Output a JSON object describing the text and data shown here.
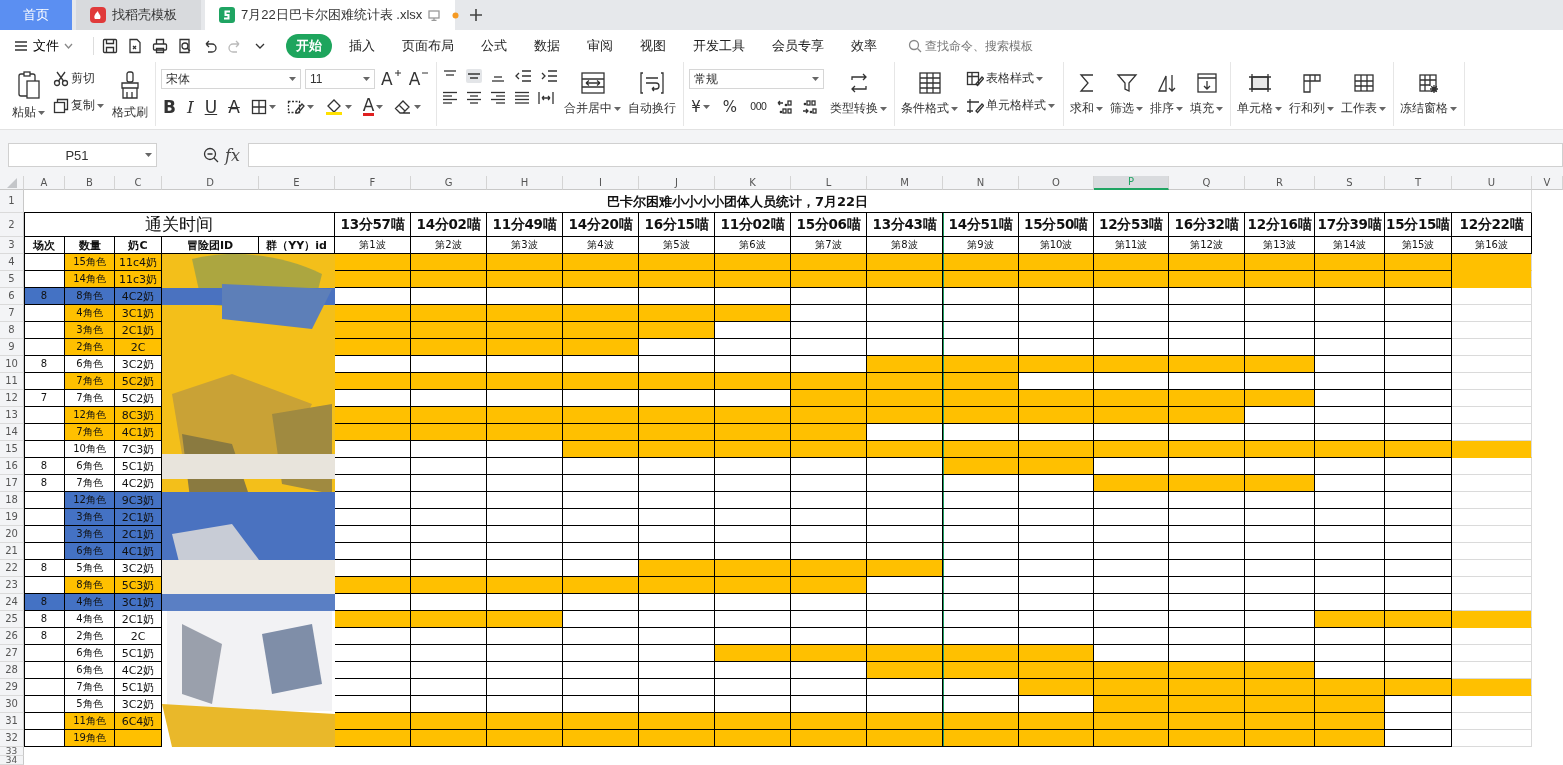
{
  "tabs": [
    {
      "label": "首页",
      "kind": "home",
      "selected": false
    },
    {
      "label": "找稻壳模板",
      "kind": "template",
      "selected": false
    },
    {
      "label": "7月22日巴卡尔困难统计表 .xlsx",
      "kind": "file",
      "selected": true,
      "unsaved": true
    }
  ],
  "menu": {
    "file": "文件",
    "tabs": [
      {
        "label": "开始",
        "selected": true
      },
      {
        "label": "插入",
        "selected": false
      },
      {
        "label": "页面布局",
        "selected": false
      },
      {
        "label": "公式",
        "selected": false
      },
      {
        "label": "数据",
        "selected": false
      },
      {
        "label": "审阅",
        "selected": false
      },
      {
        "label": "视图",
        "selected": false
      },
      {
        "label": "开发工具",
        "selected": false
      },
      {
        "label": "会员专享",
        "selected": false
      },
      {
        "label": "效率",
        "selected": false
      }
    ],
    "search": {
      "placeholder": "查找命令、搜索模板"
    }
  },
  "ribbon": [
    {
      "kind": "clipboard",
      "paste": "粘贴",
      "cut": "剪切",
      "copy": "复制",
      "painter": "格式刷"
    },
    {
      "kind": "font",
      "font": "宋体",
      "size": "11",
      "grow": "A",
      "shrink": "A",
      "bold": "B",
      "italic": "I",
      "underline": "U",
      "strike": "A",
      "font_color": "A"
    },
    {
      "kind": "align",
      "merge": "合并居中",
      "wrap": "自动换行"
    },
    {
      "kind": "number",
      "format": "常规",
      "currency": "¥",
      "percent": "%",
      "thousands": "000",
      "convert": "类型转换"
    },
    {
      "kind": "styles",
      "conditional": "条件格式",
      "table_style": "表格样式",
      "cell_style": "单元格样式"
    },
    {
      "kind": "buttons",
      "items": [
        "求和",
        "筛选",
        "排序",
        "填充"
      ]
    },
    {
      "kind": "buttons",
      "items": [
        "单元格",
        "行和列",
        "工作表"
      ]
    },
    {
      "kind": "buttons",
      "items": [
        "冻结窗格"
      ]
    }
  ],
  "formula_bar": {
    "name_box": "P51",
    "fx": "fx"
  },
  "sheet": {
    "columns": [
      {
        "letter": "A",
        "selected": false
      },
      {
        "letter": "B",
        "selected": false
      },
      {
        "letter": "C",
        "selected": false
      },
      {
        "letter": "D",
        "selected": false
      },
      {
        "letter": "E",
        "selected": false
      },
      {
        "letter": "F",
        "selected": false
      },
      {
        "letter": "G",
        "selected": false
      },
      {
        "letter": "H",
        "selected": false
      },
      {
        "letter": "I",
        "selected": false
      },
      {
        "letter": "J",
        "selected": false
      },
      {
        "letter": "K",
        "selected": false
      },
      {
        "letter": "L",
        "selected": false
      },
      {
        "letter": "M",
        "selected": false
      },
      {
        "letter": "N",
        "selected": false
      },
      {
        "letter": "O",
        "selected": false
      },
      {
        "letter": "P",
        "selected": true
      },
      {
        "letter": "Q",
        "selected": false
      },
      {
        "letter": "R",
        "selected": false
      },
      {
        "letter": "S",
        "selected": false
      },
      {
        "letter": "T",
        "selected": false
      },
      {
        "letter": "U",
        "selected": false
      },
      {
        "letter": "V",
        "selected": false
      }
    ],
    "title": {
      "row": "1",
      "text": "巴卡尔困难小小小小团体人员统计，7月22日"
    },
    "time_row": {
      "row": "2",
      "label": "通关时间",
      "times": [
        "13分57喵",
        "14分02喵",
        "11分49喵",
        "14分20喵",
        "16分15喵",
        "11分02喵",
        "15分06喵",
        "13分43喵",
        "14分51喵",
        "15分50喵",
        "12分53喵",
        "16分32喵",
        "12分16喵",
        "17分39喵",
        "15分15喵",
        "12分22喵"
      ]
    },
    "header_row": {
      "row": "3",
      "headers": [
        "场次",
        "数量",
        "奶C",
        "冒险团ID",
        "群（YY）id"
      ],
      "waves": [
        "第1波",
        "第2波",
        "第3波",
        "第4波",
        "第5波",
        "第6波",
        "第7波",
        "第8波",
        "第9波",
        "第10波",
        "第11波",
        "第12波",
        "第13波",
        "第14波",
        "第15波",
        "第16波"
      ]
    },
    "rows": [
      {
        "row": "4",
        "session": {
          "color": "#ffffff"
        },
        "count": "15角色",
        "healer": "11c4奶",
        "color": "#ffc000",
        "filled": [
          true,
          true,
          true,
          true,
          true,
          true,
          true,
          true,
          true,
          true,
          true,
          true,
          true,
          true,
          true,
          true
        ]
      },
      {
        "row": "5",
        "session": {
          "color": "#ffffff"
        },
        "count": "14角色",
        "healer": "11c3奶",
        "color": "#ffc000",
        "filled": [
          true,
          true,
          true,
          true,
          true,
          true,
          true,
          true,
          true,
          true,
          true,
          true,
          true,
          true,
          true,
          true
        ]
      },
      {
        "row": "6",
        "session": {
          "text": "8",
          "color": "#4472c4"
        },
        "count": "8角色",
        "healer": "4C2奶",
        "color": "#4472c4",
        "filled": [
          false,
          false,
          false,
          false,
          false,
          false,
          false,
          false,
          false,
          false,
          false,
          false,
          false,
          false,
          false,
          false
        ]
      },
      {
        "row": "7",
        "session": {
          "color": "#ffffff"
        },
        "count": "4角色",
        "healer": "3C1奶",
        "color": "#ffc000",
        "filled": [
          true,
          true,
          true,
          true,
          true,
          true,
          false,
          false,
          false,
          false,
          false,
          false,
          false,
          false,
          false,
          false
        ]
      },
      {
        "row": "8",
        "session": {
          "color": "#ffffff"
        },
        "count": "3角色",
        "healer": "2C1奶",
        "color": "#ffc000",
        "filled": [
          true,
          true,
          true,
          true,
          true,
          false,
          false,
          false,
          false,
          false,
          false,
          false,
          false,
          false,
          false,
          false
        ]
      },
      {
        "row": "9",
        "session": {
          "color": "#ffffff"
        },
        "count": "2角色",
        "healer": "2C",
        "color": "#ffc000",
        "filled": [
          true,
          true,
          true,
          true,
          false,
          false,
          false,
          false,
          false,
          false,
          false,
          false,
          false,
          false,
          false,
          false
        ]
      },
      {
        "row": "10",
        "session": {
          "text": "8",
          "color": "#ffffff"
        },
        "count": "6角色",
        "healer": "3C2奶",
        "color": "#ffffff",
        "filled": [
          false,
          false,
          false,
          false,
          false,
          false,
          false,
          true,
          true,
          true,
          true,
          true,
          true,
          false,
          false,
          false
        ]
      },
      {
        "row": "11",
        "session": {
          "color": "#ffffff"
        },
        "count": "7角色",
        "healer": "5C2奶",
        "color": "#ffc000",
        "filled": [
          true,
          true,
          true,
          true,
          true,
          true,
          true,
          true,
          true,
          false,
          false,
          false,
          false,
          false,
          false,
          false
        ]
      },
      {
        "row": "12",
        "session": {
          "text": "7",
          "color": "#ffffff"
        },
        "count": "7角色",
        "healer": "5C2奶",
        "color": "#ffffff",
        "filled": [
          false,
          false,
          false,
          false,
          false,
          false,
          true,
          true,
          true,
          true,
          true,
          true,
          true,
          false,
          false,
          false
        ]
      },
      {
        "row": "13",
        "session": {
          "color": "#ffffff"
        },
        "count": "12角色",
        "healer": "8C3奶",
        "color": "#ffc000",
        "filled": [
          true,
          true,
          true,
          true,
          true,
          true,
          true,
          true,
          true,
          true,
          true,
          true,
          false,
          false,
          false,
          false
        ]
      },
      {
        "row": "14",
        "session": {
          "color": "#ffffff"
        },
        "count": "7角色",
        "healer": "4C1奶",
        "color": "#ffc000",
        "filled": [
          true,
          true,
          true,
          true,
          true,
          true,
          true,
          false,
          false,
          false,
          false,
          false,
          false,
          false,
          false,
          false
        ]
      },
      {
        "row": "15",
        "session": {
          "color": "#ffffff"
        },
        "count": "10角色",
        "healer": "7C3奶",
        "color": "#ffffff",
        "filled": [
          false,
          false,
          false,
          true,
          true,
          true,
          true,
          true,
          true,
          true,
          true,
          true,
          true,
          true,
          true,
          true
        ]
      },
      {
        "row": "16",
        "session": {
          "text": "8",
          "color": "#ffffff"
        },
        "count": "6角色",
        "healer": "5C1奶",
        "color": "#ffffff",
        "filled": [
          false,
          false,
          false,
          false,
          false,
          false,
          false,
          false,
          true,
          true,
          false,
          false,
          false,
          false,
          false,
          false
        ]
      },
      {
        "row": "17",
        "session": {
          "text": "8",
          "color": "#ffffff"
        },
        "count": "7角色",
        "healer": "4C2奶",
        "color": "#ffffff",
        "filled": [
          false,
          false,
          false,
          false,
          false,
          false,
          false,
          false,
          false,
          false,
          true,
          true,
          true,
          false,
          false,
          false
        ]
      },
      {
        "row": "18",
        "session": {
          "color": "#ffffff"
        },
        "count": "12角色",
        "healer": "9C3奶",
        "color": "#4472c4",
        "filled": [
          false,
          false,
          false,
          false,
          false,
          false,
          false,
          false,
          false,
          false,
          false,
          false,
          false,
          false,
          false,
          false
        ]
      },
      {
        "row": "19",
        "session": {
          "color": "#ffffff"
        },
        "count": "3角色",
        "healer": "2C1奶",
        "color": "#4472c4",
        "filled": [
          false,
          false,
          false,
          false,
          false,
          false,
          false,
          false,
          false,
          false,
          false,
          false,
          false,
          false,
          false,
          false
        ]
      },
      {
        "row": "20",
        "session": {
          "color": "#ffffff"
        },
        "count": "3角色",
        "healer": "2C1奶",
        "color": "#4472c4",
        "filled": [
          false,
          false,
          false,
          false,
          false,
          false,
          false,
          false,
          false,
          false,
          false,
          false,
          false,
          false,
          false,
          false
        ]
      },
      {
        "row": "21",
        "session": {
          "color": "#ffffff"
        },
        "count": "6角色",
        "healer": "4C1奶",
        "color": "#4472c4",
        "filled": [
          false,
          false,
          false,
          false,
          false,
          false,
          false,
          false,
          false,
          false,
          false,
          false,
          false,
          false,
          false,
          false
        ]
      },
      {
        "row": "22",
        "session": {
          "text": "8",
          "color": "#ffffff"
        },
        "count": "5角色",
        "healer": "3C2奶",
        "color": "#ffffff",
        "filled": [
          false,
          false,
          false,
          false,
          true,
          true,
          true,
          true,
          false,
          false,
          false,
          false,
          false,
          false,
          false,
          false
        ]
      },
      {
        "row": "23",
        "session": {
          "color": "#ffffff"
        },
        "count": "8角色",
        "healer": "5C3奶",
        "color": "#ffc000",
        "filled": [
          true,
          true,
          true,
          true,
          true,
          true,
          true,
          false,
          false,
          false,
          false,
          false,
          false,
          false,
          false,
          false
        ]
      },
      {
        "row": "24",
        "session": {
          "text": "8",
          "color": "#4472c4"
        },
        "count": "4角色",
        "healer": "3C1奶",
        "color": "#4472c4",
        "filled": [
          false,
          false,
          false,
          false,
          false,
          false,
          false,
          false,
          false,
          false,
          false,
          false,
          false,
          false,
          false,
          false
        ]
      },
      {
        "row": "25",
        "session": {
          "text": "8",
          "color": "#ffffff"
        },
        "count": "4角色",
        "healer": "2C1奶",
        "color": "#ffffff",
        "filled": [
          true,
          true,
          true,
          false,
          false,
          false,
          false,
          false,
          false,
          false,
          false,
          false,
          false,
          true,
          true,
          true
        ]
      },
      {
        "row": "26",
        "session": {
          "text": "8",
          "color": "#ffffff"
        },
        "count": "2角色",
        "healer": "2C",
        "color": "#ffffff",
        "filled": [
          false,
          false,
          false,
          false,
          false,
          false,
          false,
          false,
          false,
          false,
          false,
          false,
          false,
          false,
          false,
          false
        ]
      },
      {
        "row": "27",
        "session": {
          "color": "#ffffff"
        },
        "count": "6角色",
        "healer": "5C1奶",
        "color": "#ffffff",
        "filled": [
          false,
          false,
          false,
          false,
          false,
          true,
          true,
          true,
          true,
          true,
          false,
          false,
          false,
          false,
          false,
          false
        ]
      },
      {
        "row": "28",
        "session": {
          "color": "#ffffff"
        },
        "count": "6角色",
        "healer": "4C2奶",
        "color": "#ffffff",
        "filled": [
          false,
          false,
          false,
          false,
          false,
          false,
          false,
          true,
          true,
          true,
          true,
          true,
          true,
          false,
          false,
          false
        ]
      },
      {
        "row": "29",
        "session": {
          "color": "#ffffff"
        },
        "count": "7角色",
        "healer": "5C1奶",
        "color": "#ffffff",
        "filled": [
          false,
          false,
          false,
          false,
          false,
          false,
          false,
          false,
          false,
          true,
          true,
          true,
          true,
          true,
          true,
          true
        ]
      },
      {
        "row": "30",
        "session": {
          "color": "#ffffff"
        },
        "count": "5角色",
        "healer": "3C2奶",
        "color": "#ffffff",
        "filled": [
          false,
          false,
          false,
          false,
          false,
          false,
          false,
          false,
          false,
          false,
          true,
          true,
          true,
          true,
          false,
          false
        ]
      },
      {
        "row": "31",
        "session": {
          "color": "#ffffff"
        },
        "count": "11角色",
        "healer": "6C4奶",
        "color": "#ffc000",
        "filled": [
          true,
          true,
          true,
          true,
          true,
          true,
          true,
          true,
          true,
          true,
          true,
          true,
          true,
          true,
          false,
          false
        ]
      },
      {
        "row": "32",
        "session": {
          "color": "#ffffff"
        },
        "count": "19角色",
        "color": "#ffc000",
        "filled": [
          true,
          true,
          true,
          true,
          true,
          true,
          true,
          true,
          true,
          true,
          true,
          true,
          true,
          true,
          false,
          false
        ]
      }
    ],
    "empty_rows": [
      "33",
      "34"
    ]
  }
}
